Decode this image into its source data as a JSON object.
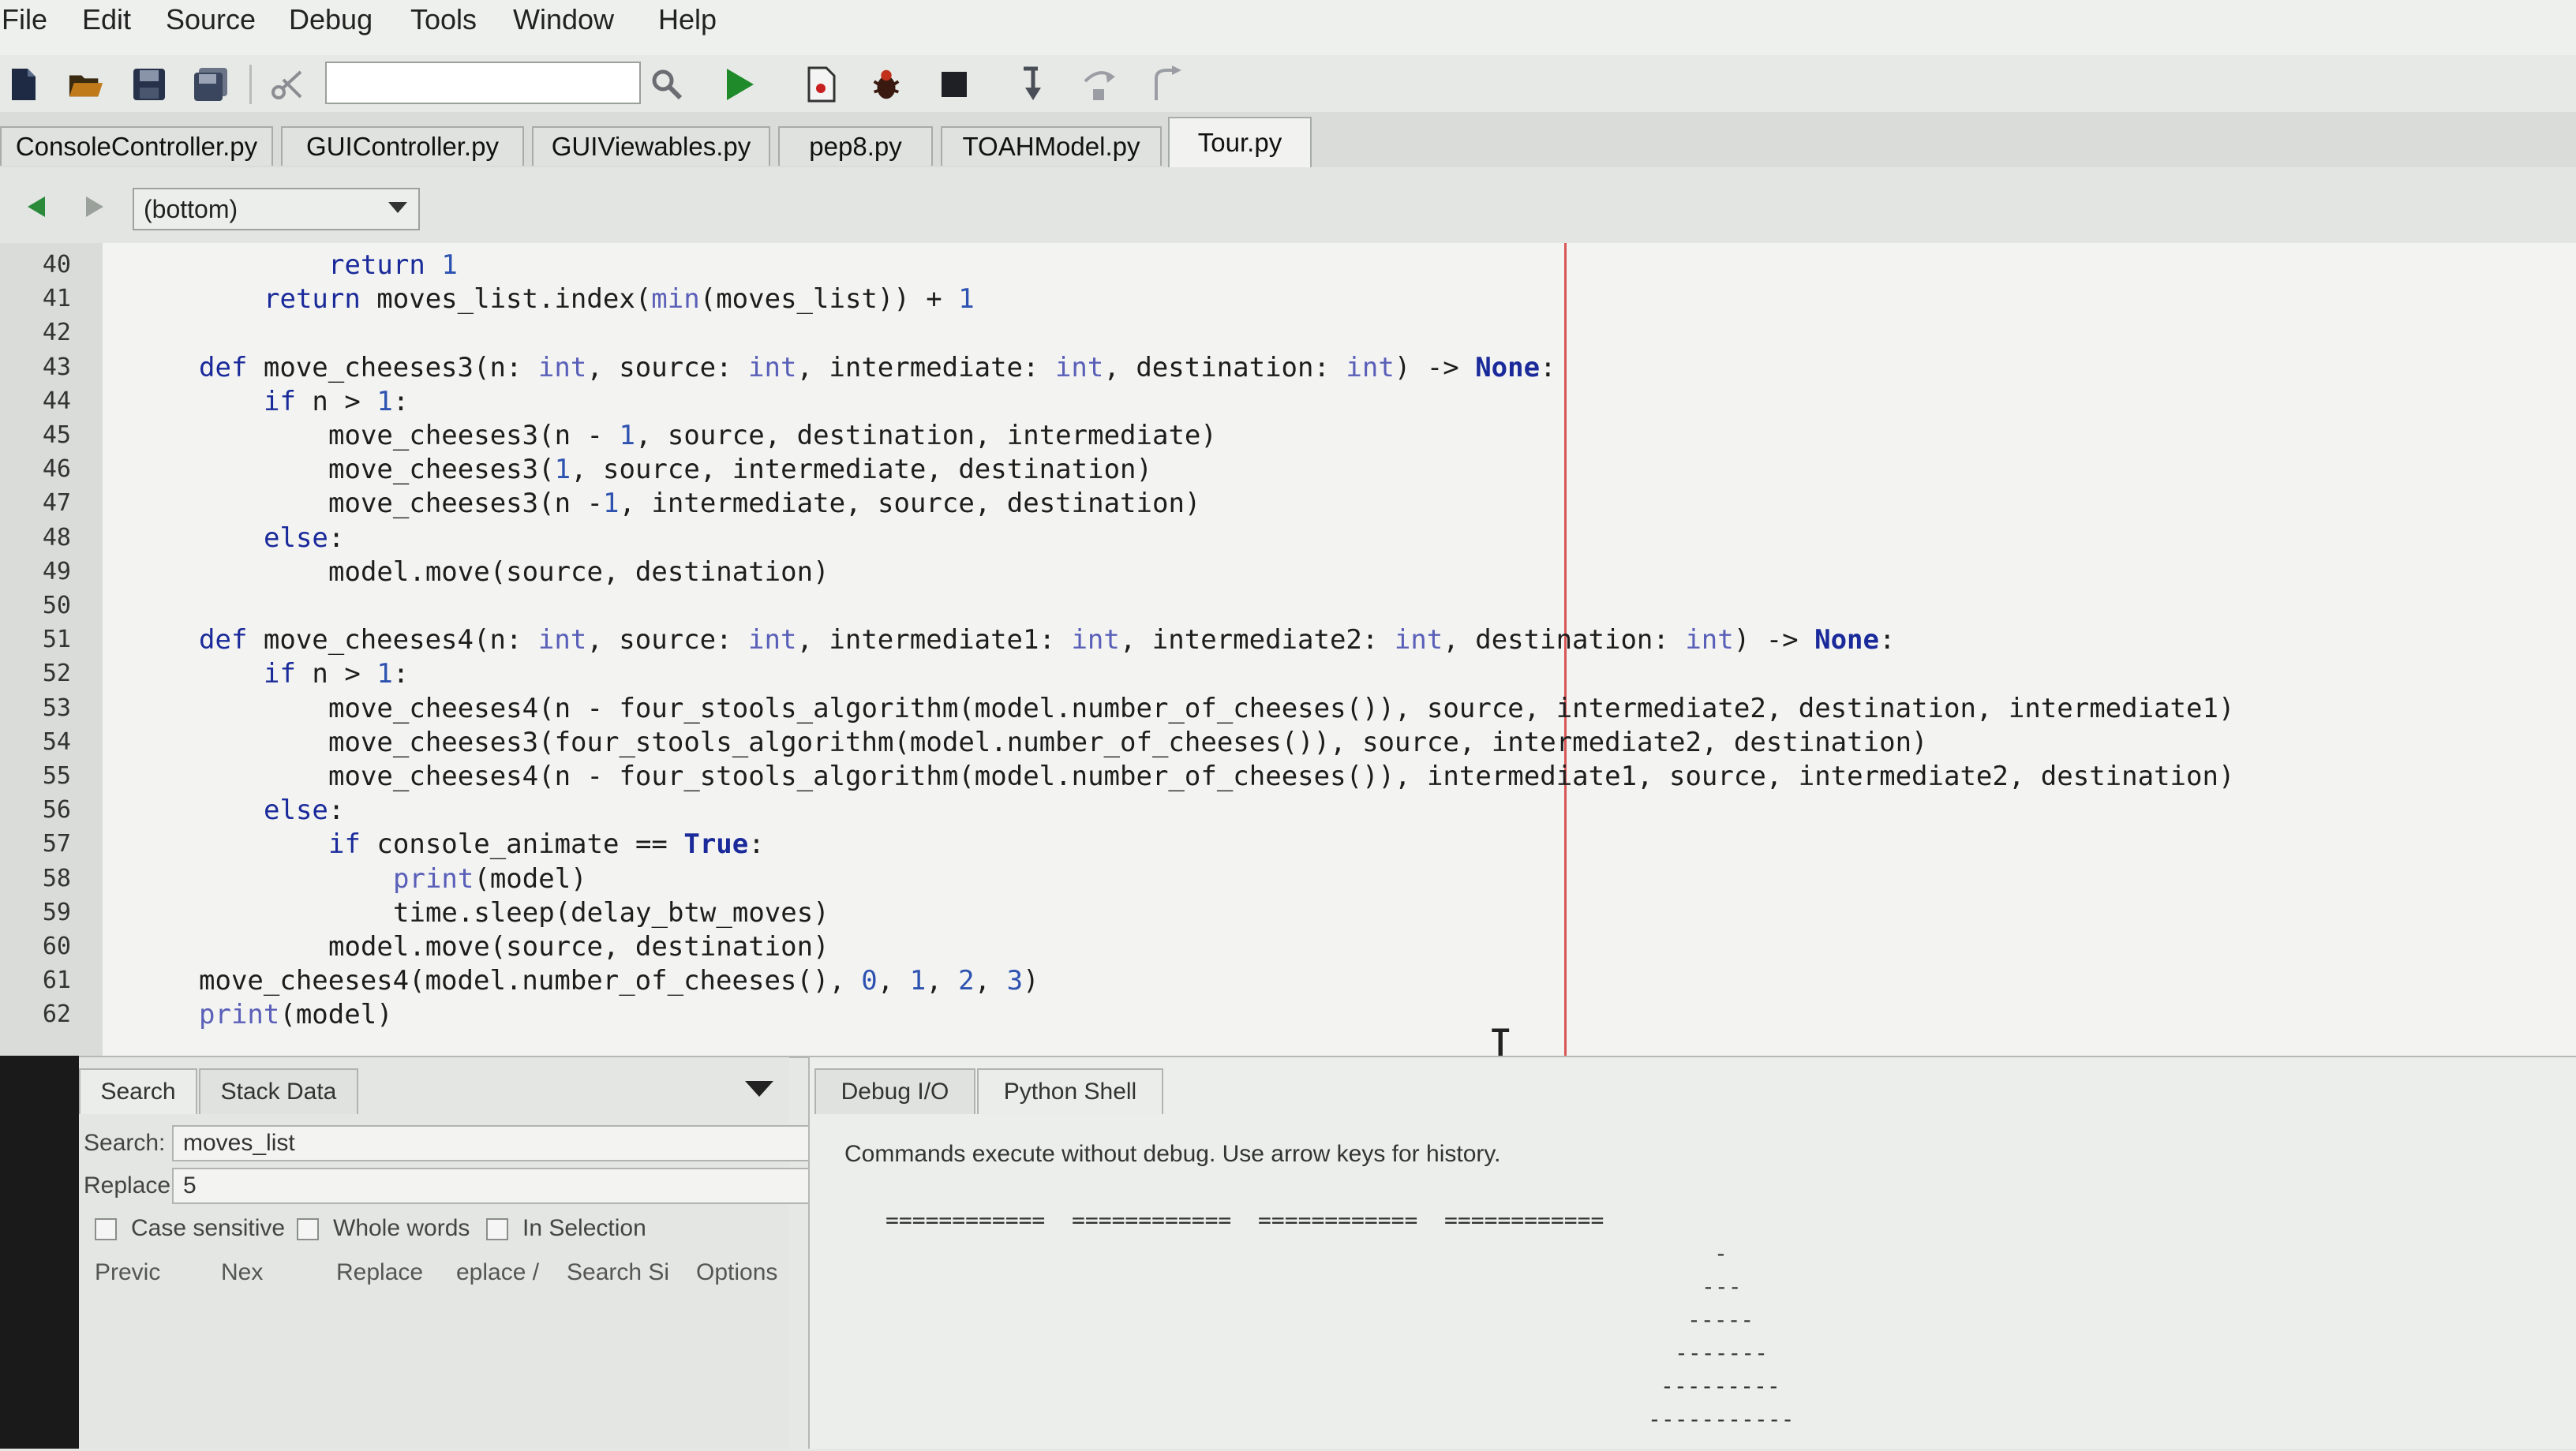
{
  "menu": [
    "File",
    "Edit",
    "Source",
    "Debug",
    "Tools",
    "Window",
    "Help"
  ],
  "toolbar": {
    "search_value": "",
    "icons": [
      "new-file-icon",
      "open-folder-icon",
      "save-icon",
      "save-all-icon",
      "cut-icon",
      "search-icon",
      "run-icon",
      "toggle-breakpoint-icon",
      "debug-bug-icon",
      "stop-icon",
      "step-into-icon",
      "step-over-icon",
      "step-out-icon"
    ]
  },
  "tabs": [
    {
      "label": "ConsoleController.py",
      "active": false
    },
    {
      "label": "GUIController.py",
      "active": false
    },
    {
      "label": "GUIViewables.py",
      "active": false
    },
    {
      "label": "pep8.py",
      "active": false
    },
    {
      "label": "TOAHModel.py",
      "active": false
    },
    {
      "label": "Tour.py",
      "active": true
    }
  ],
  "nav": {
    "scope": "(bottom)"
  },
  "editor": {
    "lines": [
      {
        "num": "40",
        "indent": 12,
        "html": "<span class='kw'>return</span> <span class='num'>1</span>"
      },
      {
        "num": "41",
        "indent": 8,
        "html": "<span class='kw'>return</span> moves_list.index(<span class='blt'>min</span>(moves_list)) + <span class='num'>1</span>"
      },
      {
        "num": "42",
        "indent": 0,
        "html": ""
      },
      {
        "num": "43",
        "indent": 4,
        "html": "<span class='kw'>def</span> move_cheeses3(n: <span class='blt'>int</span>, source: <span class='blt'>int</span>, intermediate: <span class='blt'>int</span>, destination: <span class='blt'>int</span>) -&gt; <span class='cst'>None</span>:"
      },
      {
        "num": "44",
        "indent": 8,
        "html": "<span class='kw'>if</span> n &gt; <span class='num'>1</span>:"
      },
      {
        "num": "45",
        "indent": 12,
        "html": "move_cheeses3(n - <span class='num'>1</span>, source, destination, intermediate)"
      },
      {
        "num": "46",
        "indent": 12,
        "html": "move_cheeses3(<span class='num'>1</span>, source, intermediate, destination)"
      },
      {
        "num": "47",
        "indent": 12,
        "html": "move_cheeses3(n -<span class='num'>1</span>, intermediate, source, destination)"
      },
      {
        "num": "48",
        "indent": 8,
        "html": "<span class='kw'>else</span>:"
      },
      {
        "num": "49",
        "indent": 12,
        "html": "model.move(source, destination)"
      },
      {
        "num": "50",
        "indent": 0,
        "html": ""
      },
      {
        "num": "51",
        "indent": 4,
        "html": "<span class='kw'>def</span> move_cheeses4(n: <span class='blt'>int</span>, source: <span class='blt'>int</span>, intermediate1: <span class='blt'>int</span>, intermediate2: <span class='blt'>int</span>, destination: <span class='blt'>int</span>) -&gt; <span class='cst'>None</span>:"
      },
      {
        "num": "52",
        "indent": 8,
        "html": "<span class='kw'>if</span> n &gt; <span class='num'>1</span>:"
      },
      {
        "num": "53",
        "indent": 12,
        "html": "move_cheeses4(n - four_stools_algorithm(model.number_of_cheeses()), source, intermediate2, destination, intermediate1)"
      },
      {
        "num": "54",
        "indent": 12,
        "html": "move_cheeses3(four_stools_algorithm(model.number_of_cheeses()), source, intermediate2, destination)"
      },
      {
        "num": "55",
        "indent": 12,
        "html": "move_cheeses4(n - four_stools_algorithm(model.number_of_cheeses()), intermediate1, source, intermediate2, destination)"
      },
      {
        "num": "56",
        "indent": 8,
        "html": "<span class='kw'>else</span>:"
      },
      {
        "num": "57",
        "indent": 12,
        "html": "<span class='kw'>if</span> console_animate == <span class='cst'>True</span>:"
      },
      {
        "num": "58",
        "indent": 16,
        "html": "<span class='blt'>print</span>(model)"
      },
      {
        "num": "59",
        "indent": 16,
        "html": "time.sleep(delay_btw_moves)"
      },
      {
        "num": "60",
        "indent": 12,
        "html": "model.move(source, destination)"
      },
      {
        "num": "61",
        "indent": 4,
        "html": "move_cheeses4(model.number_of_cheeses(), <span class='num'>0</span>, <span class='num'>1</span>, <span class='num'>2</span>, <span class='num'>3</span>)"
      },
      {
        "num": "62",
        "indent": 4,
        "html": "<span class='blt'>print</span>(model)"
      }
    ]
  },
  "search_panel": {
    "tabs": [
      "Search",
      "Stack Data"
    ],
    "search_label": "Search:",
    "search_value": "moves_list",
    "replace_label": "Replace:",
    "replace_value": "5",
    "options": [
      "Case sensitive",
      "Whole words",
      "In Selection"
    ],
    "buttons": [
      "Previc",
      "Nex",
      "Replace",
      "eplace /",
      "Search Si",
      "Options"
    ]
  },
  "shell_panel": {
    "tabs": [
      "Debug I/O",
      "Python Shell"
    ],
    "active_tab": "Python Shell",
    "message": "Commands execute without debug.  Use arrow keys for history.",
    "output": [
      "============  ============  ============  ============",
      "-",
      "---",
      "-----",
      "-------",
      "---------",
      "-----------"
    ]
  }
}
